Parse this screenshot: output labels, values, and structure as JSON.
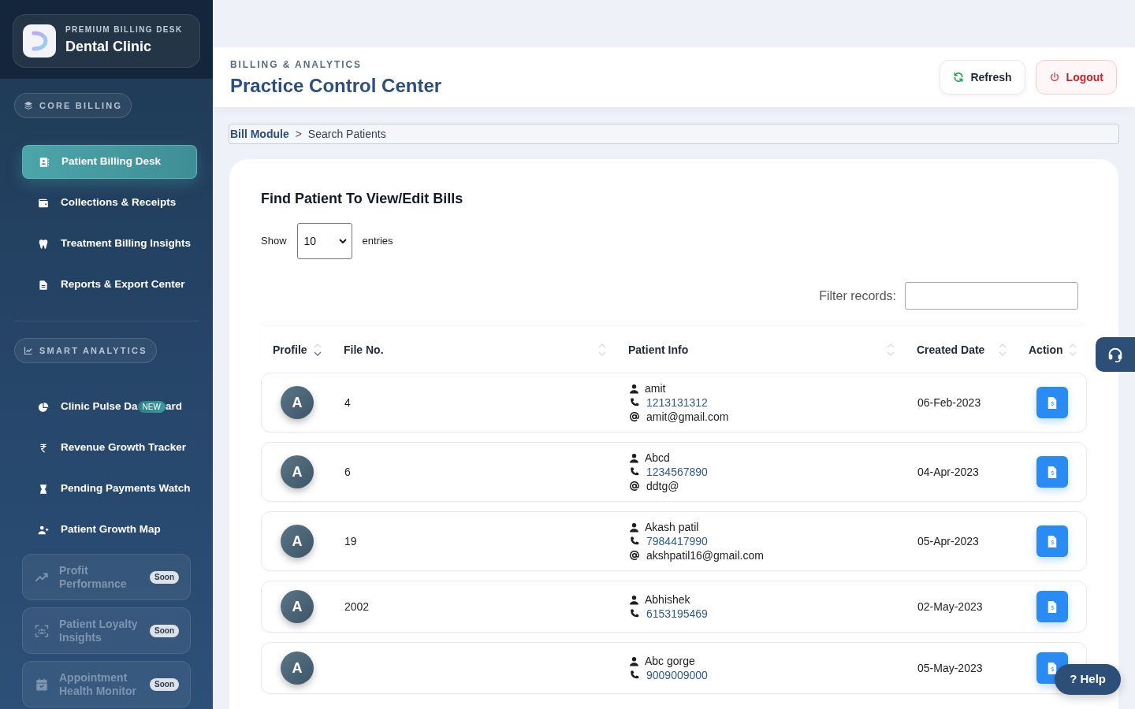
{
  "sidebar": {
    "brand": {
      "eyebrow": "PREMIUM BILLING DESK",
      "name": "Dental Clinic"
    },
    "sections": [
      {
        "label": "CORE BILLING",
        "items": [
          {
            "label": "Patient Billing Desk",
            "selected": true,
            "disabled": false
          },
          {
            "label": "Collections & Receipts",
            "selected": false,
            "disabled": false
          },
          {
            "label": "Treatment Billing Insights",
            "selected": false,
            "disabled": false
          },
          {
            "label": "Reports & Export Center",
            "selected": false,
            "disabled": false
          }
        ]
      },
      {
        "label": "SMART ANALYTICS",
        "items": [
          {
            "label": "Clinic Pulse Da",
            "badge": {
              "text": "NEW",
              "kind": "new"
            },
            "label_after_badge": "ard",
            "selected": false,
            "disabled": false
          },
          {
            "label": "Revenue Growth Tracker",
            "selected": false,
            "disabled": false
          },
          {
            "label": "Pending Payments Watch",
            "selected": false,
            "disabled": false
          },
          {
            "label": "Patient Growth Map",
            "selected": false,
            "disabled": false
          },
          {
            "label": "Profit Performance",
            "badge": {
              "text": "Soon",
              "kind": "soon"
            },
            "selected": false,
            "disabled": true
          },
          {
            "label": "Patient Loyalty Insights",
            "badge": {
              "text": "Soon",
              "kind": "soon"
            },
            "selected": false,
            "disabled": true
          },
          {
            "label": "Appointment Health Monitor",
            "badge": {
              "text": "Soon",
              "kind": "soon"
            },
            "selected": false,
            "disabled": true
          }
        ]
      }
    ]
  },
  "header": {
    "eyebrow": "BILLING & ANALYTICS",
    "title": "Practice Control Center",
    "buttons": [
      {
        "label": "Refresh",
        "kind": "refresh"
      },
      {
        "label": "Logout",
        "kind": "logout"
      }
    ]
  },
  "breadcrumb": {
    "items": [
      "Bill Module",
      "Search Patients"
    ],
    "separator": ">"
  },
  "panel": {
    "title": "Find Patient To View/Edit Bills",
    "length": {
      "label": "Show",
      "value": "10",
      "suffix": "entries"
    },
    "filter": {
      "label": "Filter records:"
    }
  },
  "table": {
    "columns": [
      {
        "label": "Profile",
        "sorted": true
      },
      {
        "label": "File No.",
        "sorted": false
      },
      {
        "label": "Patient Info",
        "sorted": false
      },
      {
        "label": "Created Date",
        "sorted": false
      },
      {
        "label": "Action",
        "sorted": false
      }
    ],
    "rows": [
      {
        "avatar": "A",
        "file_no": "4",
        "name": "amit",
        "phone": "1213131312",
        "email": "amit@gmail.com",
        "created": "06-Feb-2023"
      },
      {
        "avatar": "A",
        "file_no": "6",
        "name": "Abcd",
        "phone": "1234567890",
        "email": "ddtg@",
        "created": "04-Apr-2023"
      },
      {
        "avatar": "A",
        "file_no": "19",
        "name": "Akash patil",
        "phone": "7984417990",
        "email": "akshpatil16@gmail.com",
        "created": "05-Apr-2023"
      },
      {
        "avatar": "A",
        "file_no": "2002",
        "name": "Abhishek",
        "phone": "6153195469",
        "created": "02-May-2023"
      },
      {
        "avatar": "A",
        "name": "Abc gorge",
        "phone": "9009009000",
        "created": "05-May-2023"
      }
    ]
  },
  "help": {
    "label": "? Help"
  }
}
